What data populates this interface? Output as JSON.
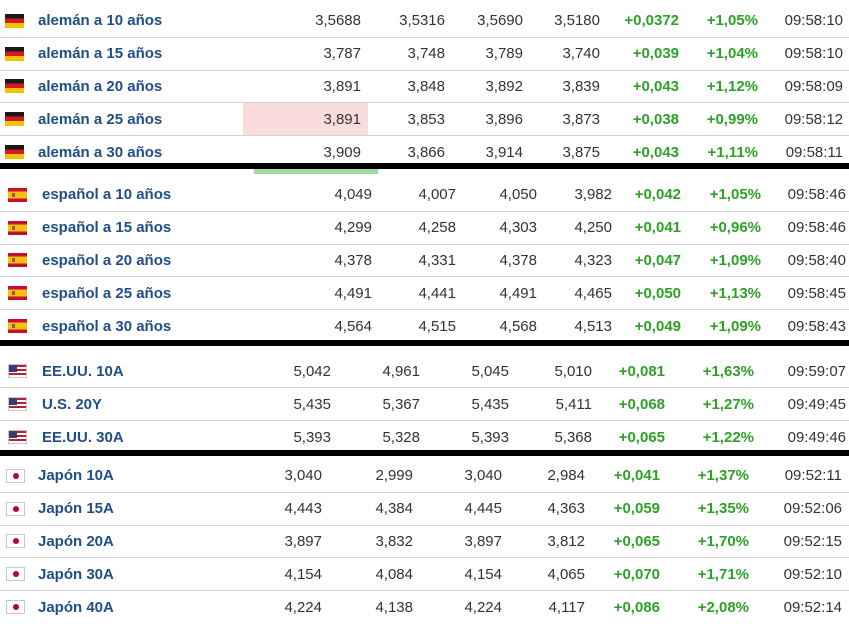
{
  "colors": {
    "name": "#1f4f86",
    "positive": "#2ea226",
    "separator": "#000000",
    "highlight_down": "#fadcdc",
    "highlight_up": "#9fdc9f"
  },
  "groups": [
    {
      "flag": "germany-flag-icon",
      "rows": [
        {
          "name": "alemán a 10 años",
          "last": "3,5688",
          "prev": "3,5316",
          "high": "3,5690",
          "low": "3,5180",
          "chg": "+0,0372",
          "pct": "+1,05%",
          "time": "09:58:10"
        },
        {
          "name": "alemán a 15 años",
          "last": "3,787",
          "prev": "3,748",
          "high": "3,789",
          "low": "3,740",
          "chg": "+0,039",
          "pct": "+1,04%",
          "time": "09:58:10"
        },
        {
          "name": "alemán a 20 años",
          "last": "3,891",
          "prev": "3,848",
          "high": "3,892",
          "low": "3,839",
          "chg": "+0,043",
          "pct": "+1,12%",
          "time": "09:58:09"
        },
        {
          "name": "alemán a 25 años",
          "last": "3,891",
          "prev": "3,853",
          "high": "3,896",
          "low": "3,873",
          "chg": "+0,038",
          "pct": "+0,99%",
          "time": "09:58:12"
        },
        {
          "name": "alemán a 30 años",
          "last": "3,909",
          "prev": "3,866",
          "high": "3,914",
          "low": "3,875",
          "chg": "+0,043",
          "pct": "+1,11%",
          "time": "09:58:11"
        }
      ]
    },
    {
      "flag": "spain-flag-icon",
      "rows": [
        {
          "name": "español a 10 años",
          "last": "4,049",
          "prev": "4,007",
          "high": "4,050",
          "low": "3,982",
          "chg": "+0,042",
          "pct": "+1,05%",
          "time": "09:58:46"
        },
        {
          "name": "español a 15 años",
          "last": "4,299",
          "prev": "4,258",
          "high": "4,303",
          "low": "4,250",
          "chg": "+0,041",
          "pct": "+0,96%",
          "time": "09:58:46"
        },
        {
          "name": "español a 20 años",
          "last": "4,378",
          "prev": "4,331",
          "high": "4,378",
          "low": "4,323",
          "chg": "+0,047",
          "pct": "+1,09%",
          "time": "09:58:40"
        },
        {
          "name": "español a 25 años",
          "last": "4,491",
          "prev": "4,441",
          "high": "4,491",
          "low": "4,465",
          "chg": "+0,050",
          "pct": "+1,13%",
          "time": "09:58:45"
        },
        {
          "name": "español a 30 años",
          "last": "4,564",
          "prev": "4,515",
          "high": "4,568",
          "low": "4,513",
          "chg": "+0,049",
          "pct": "+1,09%",
          "time": "09:58:43"
        }
      ]
    },
    {
      "flag": "usa-flag-icon",
      "rows": [
        {
          "name": "EE.UU. 10A",
          "last": "5,042",
          "prev": "4,961",
          "high": "5,045",
          "low": "5,010",
          "chg": "+0,081",
          "pct": "+1,63%",
          "time": "09:59:07"
        },
        {
          "name": "U.S. 20Y",
          "last": "5,435",
          "prev": "5,367",
          "high": "5,435",
          "low": "5,411",
          "chg": "+0,068",
          "pct": "+1,27%",
          "time": "09:49:45"
        },
        {
          "name": "EE.UU. 30A",
          "last": "5,393",
          "prev": "5,328",
          "high": "5,393",
          "low": "5,368",
          "chg": "+0,065",
          "pct": "+1,22%",
          "time": "09:49:46"
        }
      ]
    },
    {
      "flag": "japan-flag-icon",
      "rows": [
        {
          "name": "Japón 10A",
          "last": "3,040",
          "prev": "2,999",
          "high": "3,040",
          "low": "2,984",
          "chg": "+0,041",
          "pct": "+1,37%",
          "time": "09:52:11"
        },
        {
          "name": "Japón 15A",
          "last": "4,443",
          "prev": "4,384",
          "high": "4,445",
          "low": "4,363",
          "chg": "+0,059",
          "pct": "+1,35%",
          "time": "09:52:06"
        },
        {
          "name": "Japón 20A",
          "last": "3,897",
          "prev": "3,832",
          "high": "3,897",
          "low": "3,812",
          "chg": "+0,065",
          "pct": "+1,70%",
          "time": "09:52:15"
        },
        {
          "name": "Japón 30A",
          "last": "4,154",
          "prev": "4,084",
          "high": "4,154",
          "low": "4,065",
          "chg": "+0,070",
          "pct": "+1,71%",
          "time": "09:52:10"
        },
        {
          "name": "Japón 40A",
          "last": "4,224",
          "prev": "4,138",
          "high": "4,224",
          "low": "4,117",
          "chg": "+0,086",
          "pct": "+2,08%",
          "time": "09:52:14"
        }
      ]
    }
  ]
}
